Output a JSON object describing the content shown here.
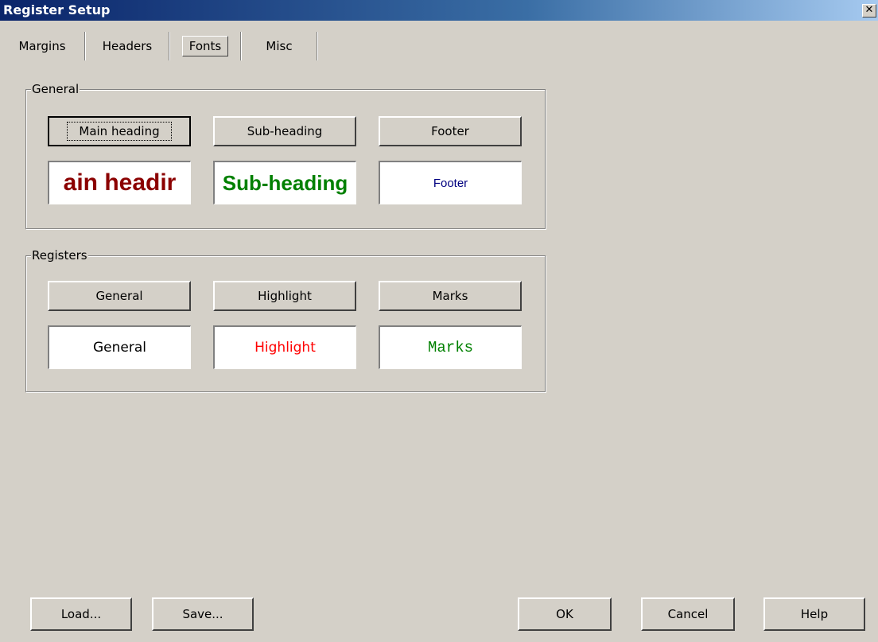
{
  "window": {
    "title": "Register Setup",
    "close_glyph": "✕"
  },
  "tabs": [
    {
      "label": "Margins",
      "active": false
    },
    {
      "label": "Headers",
      "active": false
    },
    {
      "label": "Fonts",
      "active": true
    },
    {
      "label": "Misc",
      "active": false
    }
  ],
  "general_group": {
    "label": "General",
    "buttons": [
      "Main heading",
      "Sub-heading",
      "Footer"
    ],
    "previews": [
      {
        "text": "ain headir",
        "color": "#8b0000"
      },
      {
        "text": "Sub-heading",
        "color": "#008000"
      },
      {
        "text": "Footer",
        "color": "#000080"
      }
    ]
  },
  "registers_group": {
    "label": "Registers",
    "buttons": [
      "General",
      "Highlight",
      "Marks"
    ],
    "previews": [
      {
        "text": "General",
        "color": "#000000"
      },
      {
        "text": "Highlight",
        "color": "#ff0000"
      },
      {
        "text": "Marks",
        "color": "#008000"
      }
    ]
  },
  "footer_buttons": {
    "load": "Load...",
    "save": "Save...",
    "ok": "OK",
    "cancel": "Cancel",
    "help": "Help"
  }
}
